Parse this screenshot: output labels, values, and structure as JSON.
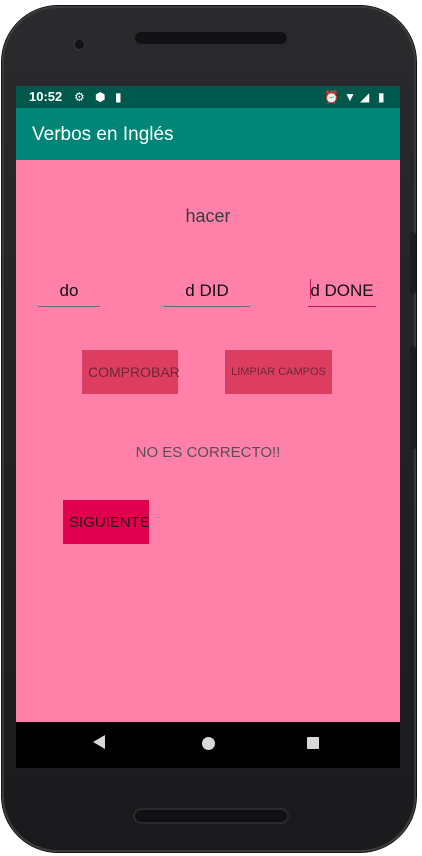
{
  "status": {
    "time": "10:52",
    "icons_left": [
      "gear-icon",
      "shield-icon",
      "sd-card-icon"
    ],
    "icons_right": [
      "alarm-icon",
      "wifi-icon",
      "signal-icon",
      "battery-icon"
    ]
  },
  "app": {
    "title": "Verbos en Inglés"
  },
  "quiz": {
    "spanish_word": "hacer",
    "field1_value": "do",
    "field2_value": "d DID",
    "field3_value": "d DONE",
    "check_label": "COMPROBAR",
    "clear_label": "LIMPIAR CAMPOS",
    "result_text": "NO ES CORRECTO!!",
    "next_label": "SIGUIENTE"
  },
  "colors": {
    "status_bar": "#00574b",
    "app_bar": "#008577",
    "background": "#ff80a8",
    "buttons": "#dd3d5f",
    "next_button": "#e0004d"
  }
}
